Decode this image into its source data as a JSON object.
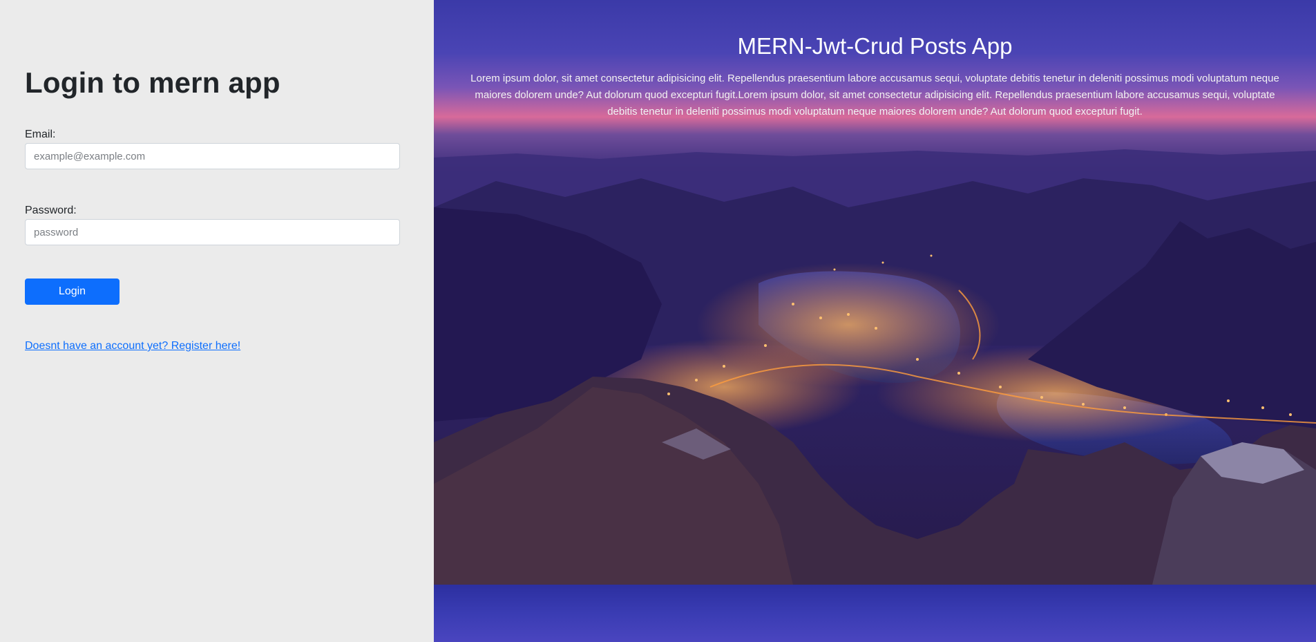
{
  "login": {
    "title": "Login to mern app",
    "email_label": "Email:",
    "email_placeholder": "example@example.com",
    "email_value": "",
    "password_label": "Password:",
    "password_placeholder": "password",
    "password_value": "",
    "button_label": "Login",
    "register_link": "Doesnt have an account yet? Register here!"
  },
  "hero": {
    "title": "MERN-Jwt-Crud Posts App",
    "description": "Lorem ipsum dolor, sit amet consectetur adipisicing elit. Repellendus praesentium labore accusamus sequi, voluptate debitis tenetur in deleniti possimus modi voluptatum neque maiores dolorem unde? Aut dolorum quod excepturi fugit.Lorem ipsum dolor, sit amet consectetur adipisicing elit. Repellendus praesentium labore accusamus sequi, voluptate debitis tenetur in deleniti possimus modi voluptatum neque maiores dolorem unde? Aut dolorum quod excepturi fugit."
  },
  "colors": {
    "page_background": "#ebebeb",
    "primary": "#0d6efd",
    "hero_sky_top": "#3b3aa8",
    "hero_sky_sunset": "#d86a9a",
    "city_lights": "#ffa24a"
  }
}
